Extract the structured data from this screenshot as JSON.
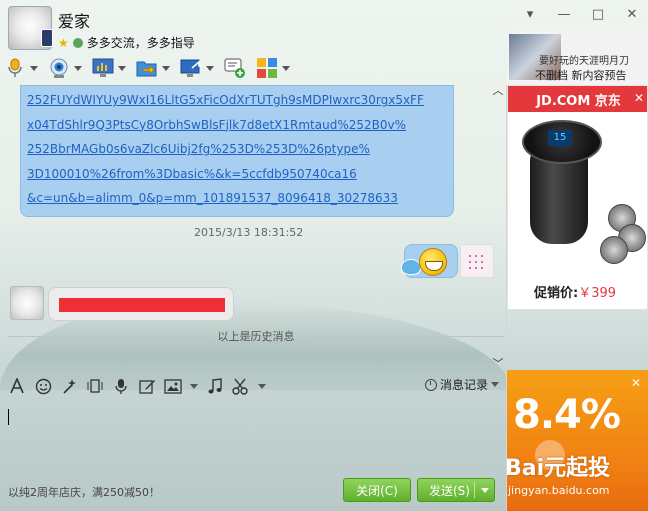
{
  "contact": {
    "name": "爱家",
    "signature": "多多交流，多多指导"
  },
  "chat": {
    "link_lines": [
      "252FUYdWIYUy9WxI16LltG5xFicOdXrTUTgh9sMDPIwxrc30rgx5xFF",
      "x04TdShlr9Q3PtsCy8OrbhSwBlsFjlk7d8etX1Rmtaud%252B0v%",
      "252BbrMAGb0s6vaZlc6Uibj2fg%253D%253D%26ptype%",
      "3D100010%26from%3Dbasic%&k=5ccfdb950740ca16",
      "&c=un&b=alimm_0&p=mm_101891537_8096418_30278633"
    ],
    "timestamp": "2015/3/13 18:31:52",
    "history_label": "以上是历史消息"
  },
  "input": {
    "message_record_label": "消息记录"
  },
  "footer": {
    "note": "以纯2周年店庆，满250减50！",
    "close_label": "关闭(C)",
    "send_label": "发送(S)"
  },
  "ads": {
    "top_line1": "要好玩的天涯明月刀",
    "top_line2": "不删档 新内容预告",
    "jd_header": "JD.COM 京东",
    "jd_price_label": "促销价:",
    "jd_price": "￥399",
    "bottom_big": "8.4%",
    "bottom_sub": "Bai元起投",
    "watermark": "jingyan.baidu.com"
  },
  "window": {
    "minimize": "—",
    "restore": "□",
    "close": "✕",
    "menu": "▾"
  }
}
